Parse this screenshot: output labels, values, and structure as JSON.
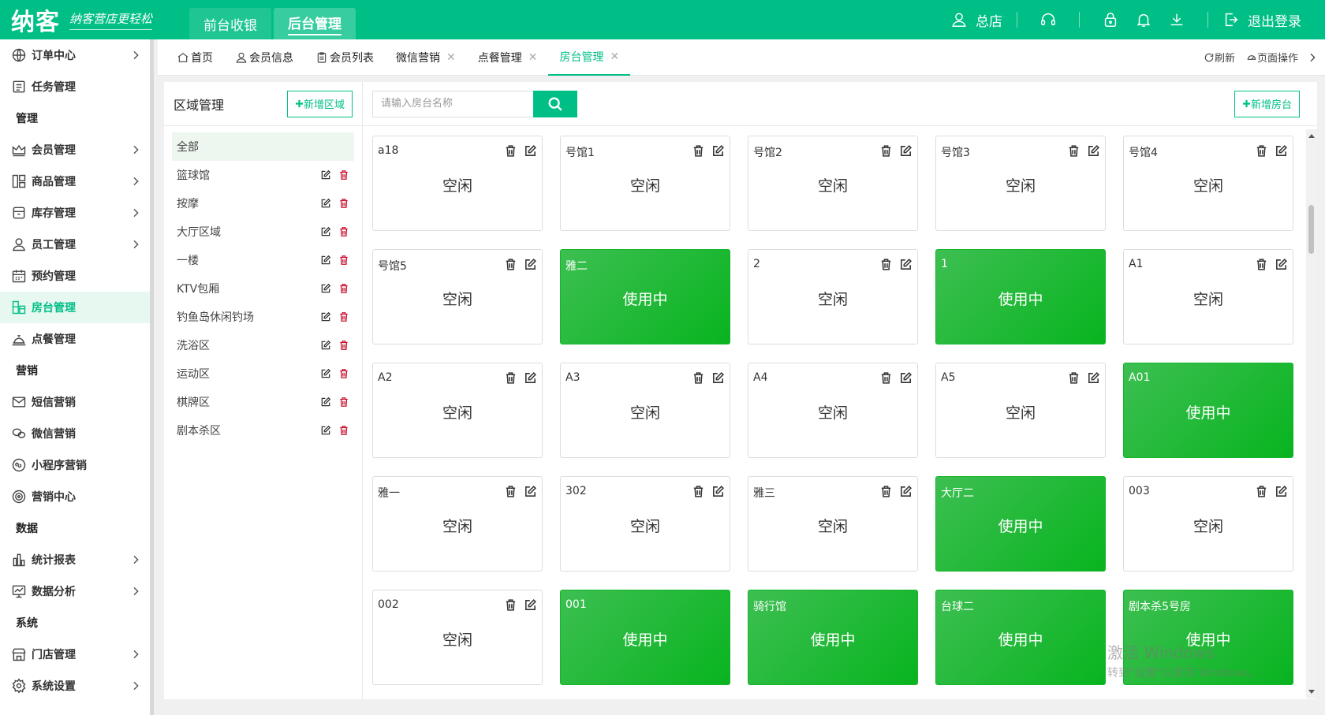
{
  "brand": {
    "name": "纳客",
    "slogan": "纳客营店更轻松"
  },
  "top_tabs": [
    {
      "label": "前台收银"
    },
    {
      "label": "后台管理"
    }
  ],
  "top_right": {
    "store_label": "总店",
    "logout_label": "退出登录"
  },
  "sidebar": {
    "items": [
      {
        "label": "订单中心",
        "type": "item",
        "icon": "globe-icon",
        "arrow": true
      },
      {
        "label": "任务管理",
        "type": "item",
        "icon": "task-icon",
        "arrow": false
      },
      {
        "label": "管理",
        "type": "header"
      },
      {
        "label": "会员管理",
        "type": "item",
        "icon": "crown-icon",
        "arrow": true
      },
      {
        "label": "商品管理",
        "type": "item",
        "icon": "goods-icon",
        "arrow": true
      },
      {
        "label": "库存管理",
        "type": "item",
        "icon": "inventory-icon",
        "arrow": true
      },
      {
        "label": "员工管理",
        "type": "item",
        "icon": "user-icon",
        "arrow": true
      },
      {
        "label": "预约管理",
        "type": "item",
        "icon": "calendar-icon",
        "arrow": false
      },
      {
        "label": "房台管理",
        "type": "item",
        "icon": "room-icon",
        "arrow": false,
        "active": true
      },
      {
        "label": "点餐管理",
        "type": "item",
        "icon": "dining-icon",
        "arrow": false
      },
      {
        "label": "营销",
        "type": "header"
      },
      {
        "label": "短信营销",
        "type": "item",
        "icon": "mail-icon",
        "arrow": false
      },
      {
        "label": "微信营销",
        "type": "item",
        "icon": "wechat-icon",
        "arrow": false
      },
      {
        "label": "小程序营销",
        "type": "item",
        "icon": "miniapp-icon",
        "arrow": false
      },
      {
        "label": "营销中心",
        "type": "item",
        "icon": "target-icon",
        "arrow": false
      },
      {
        "label": "数据",
        "type": "header"
      },
      {
        "label": "统计报表",
        "type": "item",
        "icon": "bar-chart-icon",
        "arrow": true
      },
      {
        "label": "数据分析",
        "type": "item",
        "icon": "analytics-icon",
        "arrow": true
      },
      {
        "label": "系统",
        "type": "header"
      },
      {
        "label": "门店管理",
        "type": "item",
        "icon": "store-icon",
        "arrow": true
      },
      {
        "label": "系统设置",
        "type": "item",
        "icon": "gear-icon",
        "arrow": true
      }
    ]
  },
  "tabs": [
    {
      "label": "首页",
      "icon": "home-icon",
      "closable": false
    },
    {
      "label": "会员信息",
      "icon": "user-icon",
      "closable": false
    },
    {
      "label": "会员列表",
      "icon": "clipboard-icon",
      "closable": false
    },
    {
      "label": "微信营销",
      "icon": "",
      "closable": true
    },
    {
      "label": "点餐管理",
      "icon": "",
      "closable": true
    },
    {
      "label": "房台管理",
      "icon": "",
      "closable": true,
      "active": true
    }
  ],
  "tab_tools": {
    "refresh": "刷新",
    "page_ops": "页面操作"
  },
  "area": {
    "title": "区域管理",
    "add_label": "新增区域",
    "items": [
      {
        "label": "全部",
        "selected": true,
        "actions": false
      },
      {
        "label": "篮球馆",
        "actions": true
      },
      {
        "label": "按摩",
        "actions": true
      },
      {
        "label": "大厅区域",
        "actions": true
      },
      {
        "label": "一楼",
        "actions": true
      },
      {
        "label": "KTV包厢",
        "actions": true
      },
      {
        "label": "钓鱼岛休闲钓场",
        "actions": true
      },
      {
        "label": "洗浴区",
        "actions": true
      },
      {
        "label": "运动区",
        "actions": true
      },
      {
        "label": "棋牌区",
        "actions": true
      },
      {
        "label": "剧本杀区",
        "actions": true
      }
    ]
  },
  "rooms_toolbar": {
    "search_placeholder": "请输入房台名称",
    "add_label": "新增房台"
  },
  "rooms": [
    {
      "name": "a18",
      "status": "空闲",
      "busy": false
    },
    {
      "name": "号馆1",
      "status": "空闲",
      "busy": false
    },
    {
      "name": "号馆2",
      "status": "空闲",
      "busy": false
    },
    {
      "name": "号馆3",
      "status": "空闲",
      "busy": false
    },
    {
      "name": "号馆4",
      "status": "空闲",
      "busy": false
    },
    {
      "name": "号馆5",
      "status": "空闲",
      "busy": false
    },
    {
      "name": "雅二",
      "status": "使用中",
      "busy": true
    },
    {
      "name": "2",
      "status": "空闲",
      "busy": false
    },
    {
      "name": "1",
      "status": "使用中",
      "busy": true
    },
    {
      "name": "A1",
      "status": "空闲",
      "busy": false
    },
    {
      "name": "A2",
      "status": "空闲",
      "busy": false
    },
    {
      "name": "A3",
      "status": "空闲",
      "busy": false
    },
    {
      "name": "A4",
      "status": "空闲",
      "busy": false
    },
    {
      "name": "A5",
      "status": "空闲",
      "busy": false
    },
    {
      "name": "A01",
      "status": "使用中",
      "busy": true
    },
    {
      "name": "雅一",
      "status": "空闲",
      "busy": false
    },
    {
      "name": "302",
      "status": "空闲",
      "busy": false
    },
    {
      "name": "雅三",
      "status": "空闲",
      "busy": false
    },
    {
      "name": "大厅二",
      "status": "使用中",
      "busy": true
    },
    {
      "name": "003",
      "status": "空闲",
      "busy": false
    },
    {
      "name": "002",
      "status": "空闲",
      "busy": false
    },
    {
      "name": "001",
      "status": "使用中",
      "busy": true
    },
    {
      "name": "骑行馆",
      "status": "使用中",
      "busy": true
    },
    {
      "name": "台球二",
      "status": "使用中",
      "busy": true
    },
    {
      "name": "剧本杀5号房",
      "status": "使用中",
      "busy": true
    }
  ],
  "watermark": {
    "line1": "激活 Windows",
    "line2": "转到\"设置\"以激活 Windows。"
  },
  "colors": {
    "brand": "#00bf86",
    "busy": "#14b52a",
    "danger": "#c8102e"
  }
}
